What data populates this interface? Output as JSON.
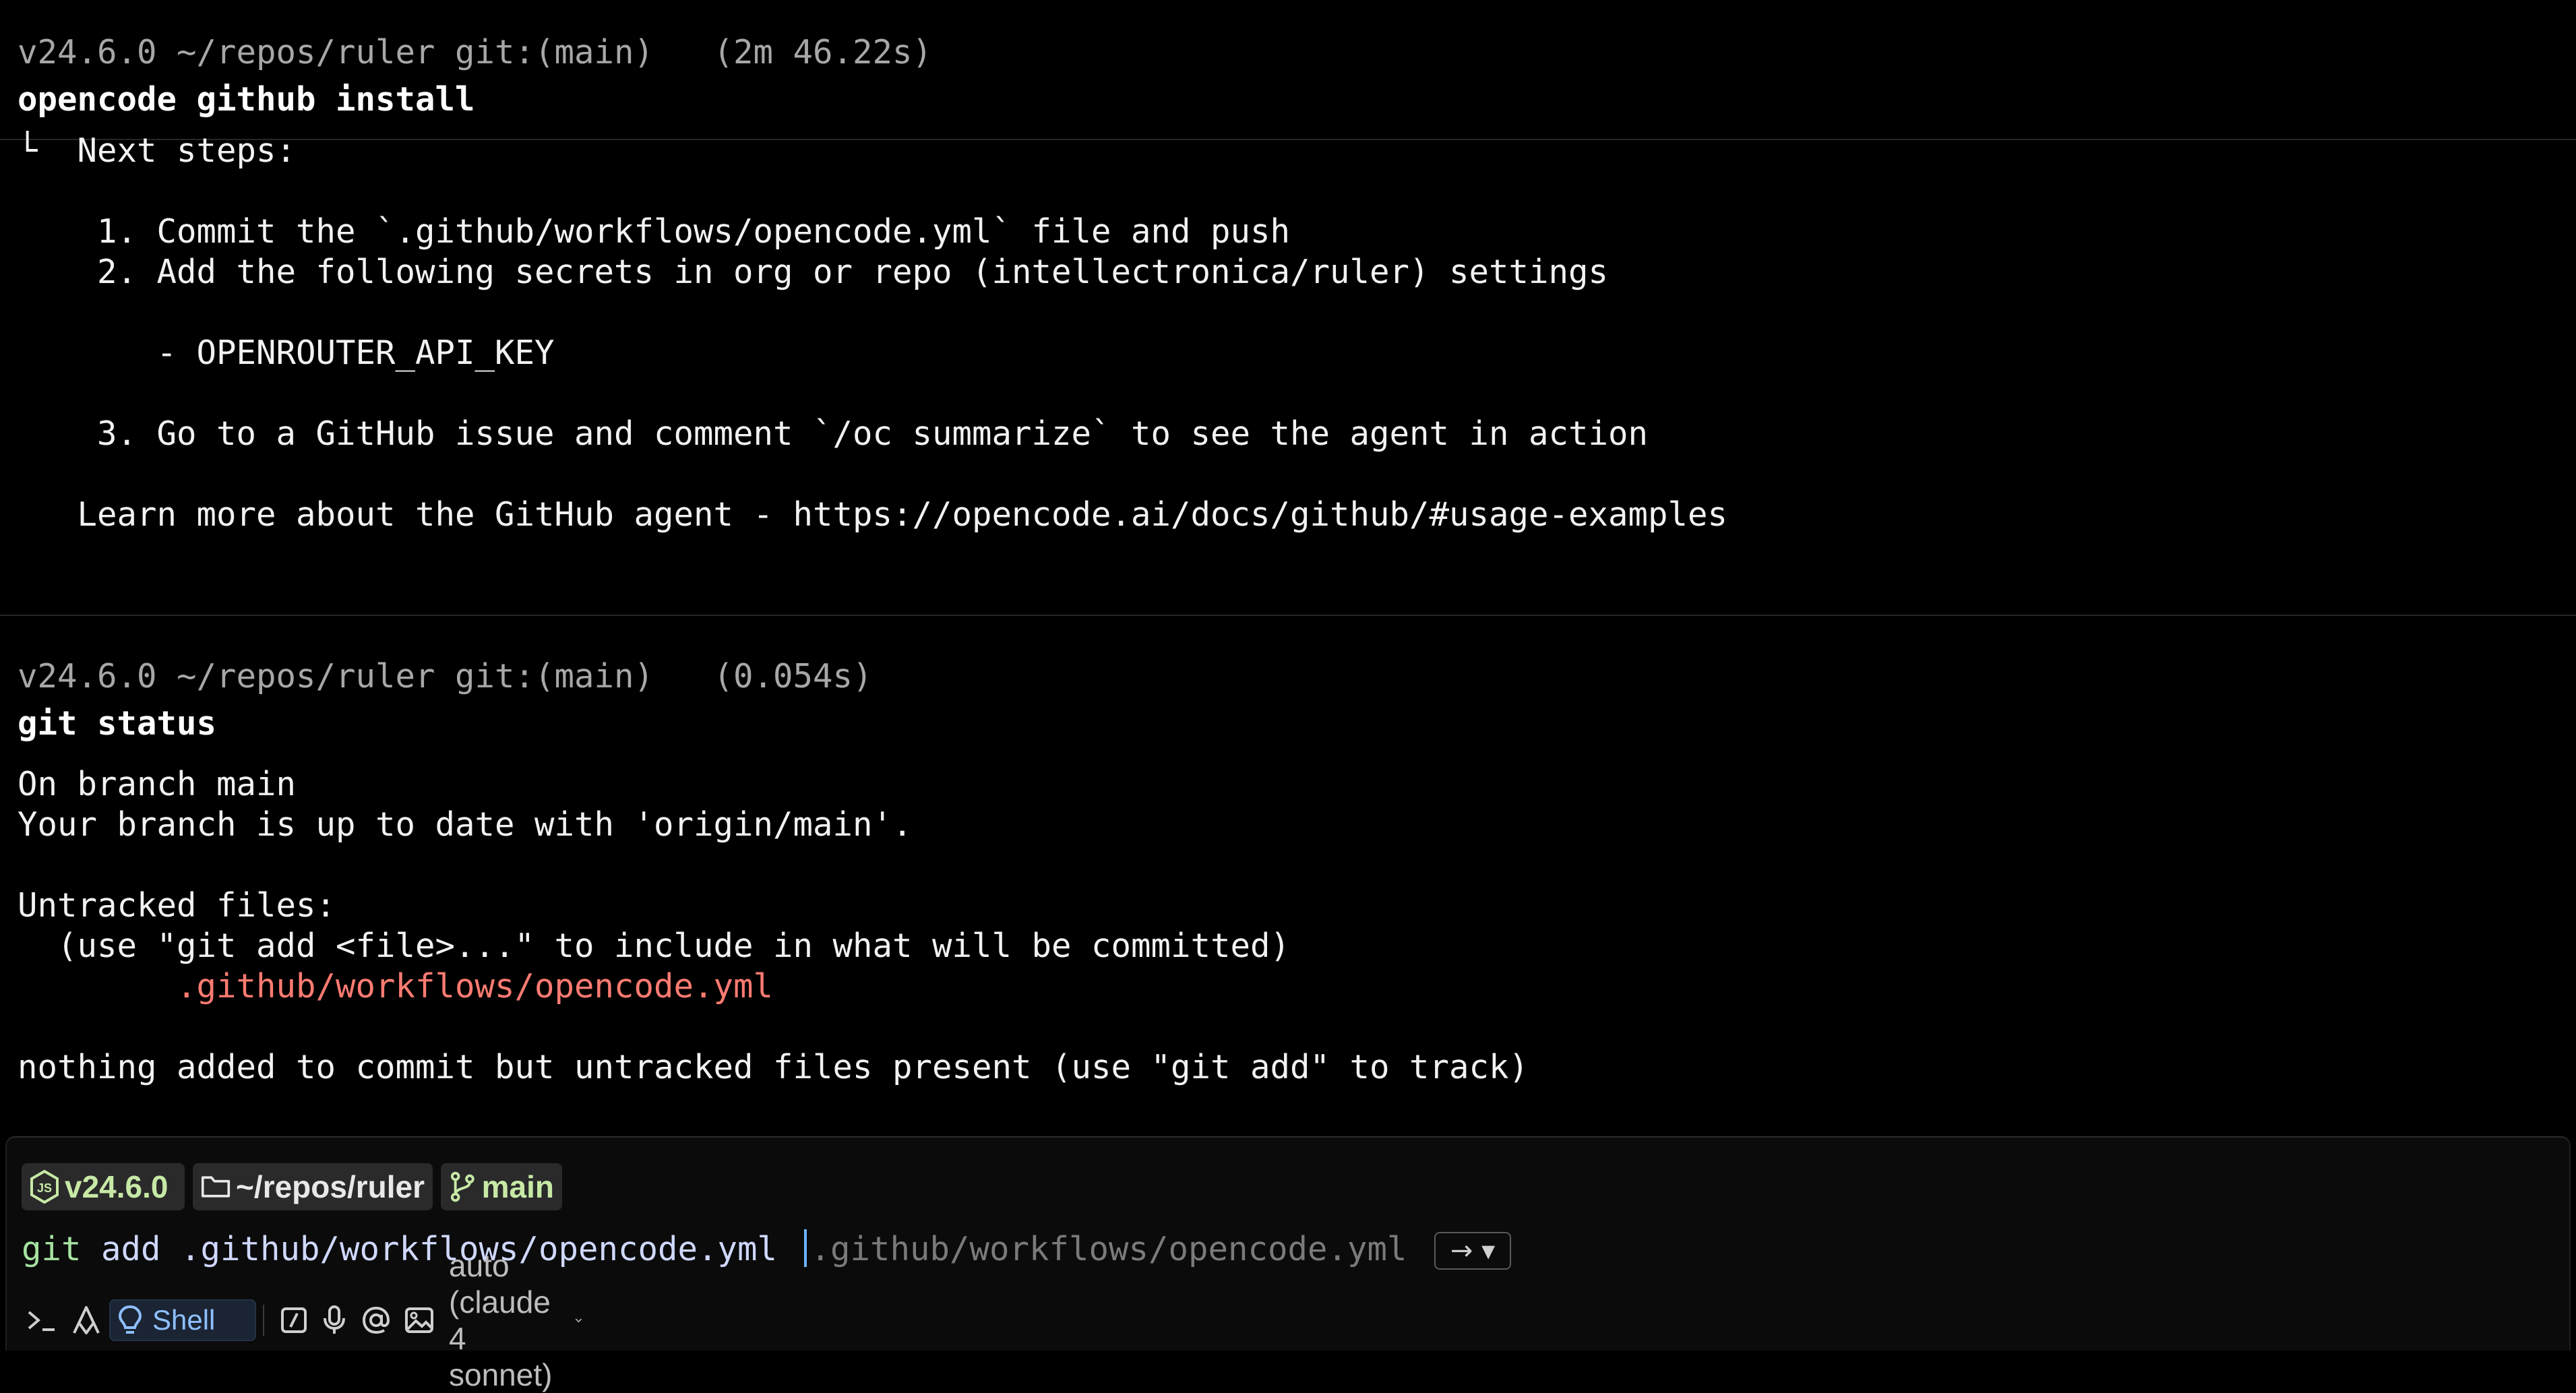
{
  "block1": {
    "meta": "v24.6.0 ~/repos/ruler git:(main)   (2m 46.22s)",
    "command": "opencode github install",
    "output": [
      "└  Next steps:",
      "",
      "    1. Commit the `.github/workflows/opencode.yml` file and push",
      "    2. Add the following secrets in org or repo (intellectronica/ruler) settings",
      "",
      "       - OPENROUTER_API_KEY",
      "",
      "    3. Go to a GitHub issue and comment `/oc summarize` to see the agent in action",
      "",
      "   Learn more about the GitHub agent - https://opencode.ai/docs/github/#usage-examples"
    ]
  },
  "block2": {
    "meta": "v24.6.0 ~/repos/ruler git:(main)   (0.054s)",
    "command": "git status",
    "output_lines": {
      "l1": "On branch main",
      "l2": "Your branch is up to date with 'origin/main'.",
      "l3": "Untracked files:",
      "l4": "  (use \"git add <file>...\" to include in what will be committed)",
      "l5": "        .github/workflows/opencode.yml",
      "l6": "nothing added to commit but untracked files present (use \"git add\" to track)"
    }
  },
  "input": {
    "chips": {
      "node_version": "v24.6.0",
      "directory": "~/repos/ruler",
      "branch": "main"
    },
    "typed_command": "git",
    "typed_args": " add .github/workflows/opencode.yml ",
    "suggestion": ".github/workflows/opencode.yml",
    "accept_label": "→ ▾",
    "toolbar": {
      "shell_label": "Shell",
      "model_label": "auto (claude 4 sonnet)"
    }
  },
  "colors": {
    "background": "#000000",
    "untracked_file": "#ff7b72",
    "chip_green": "#c7e9a6",
    "shell_blue": "#8fbfff"
  },
  "icons": [
    "node-icon",
    "folder-icon",
    "git-branch-icon",
    "terminal-icon",
    "agent-icon",
    "lightbulb-icon",
    "slash-command-icon",
    "microphone-icon",
    "at-mention-icon",
    "image-icon",
    "chevron-down-icon"
  ]
}
